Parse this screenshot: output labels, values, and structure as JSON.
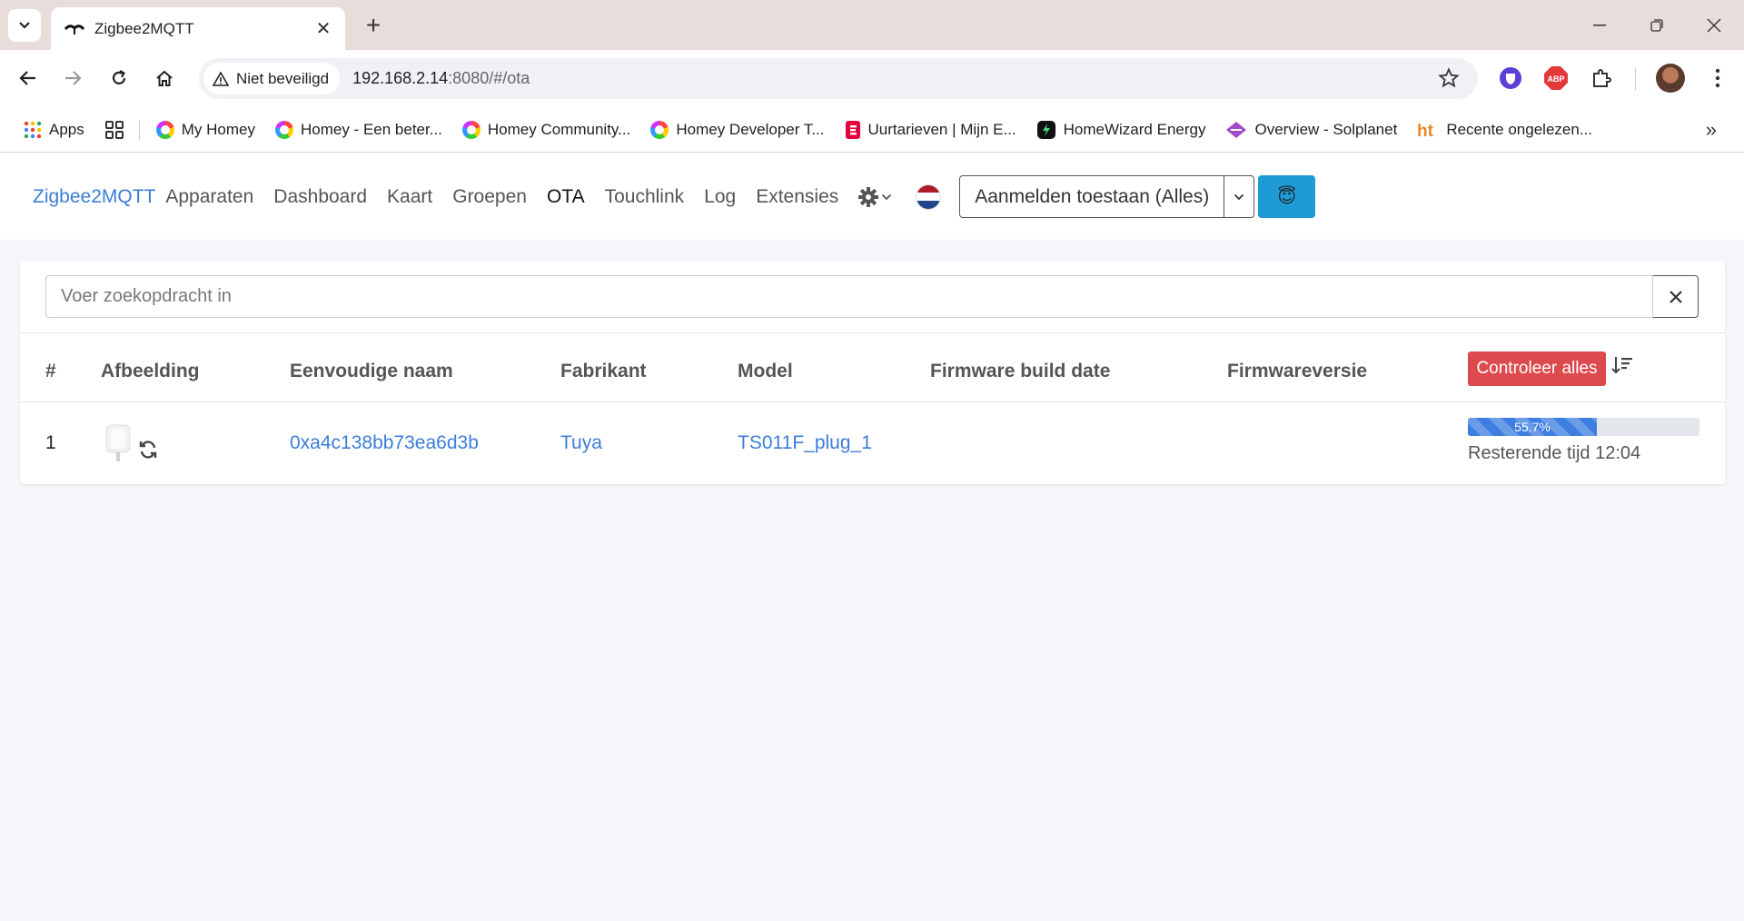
{
  "browser": {
    "tab_title": "Zigbee2MQTT",
    "security_label": "Niet beveiligd",
    "url_host": "192.168.2.14",
    "url_path": ":8080/#/ota",
    "bookmarks": [
      {
        "label": "Apps",
        "icon": "apps-grid-icon"
      },
      {
        "label": "My Homey",
        "icon": "homey-icon"
      },
      {
        "label": "Homey - Een beter...",
        "icon": "homey-icon"
      },
      {
        "label": "Homey Community...",
        "icon": "homey-icon"
      },
      {
        "label": "Homey Developer T...",
        "icon": "homey-icon"
      },
      {
        "label": "Uurtarieven | Mijn E...",
        "icon": "eneco-icon"
      },
      {
        "label": "HomeWizard Energy",
        "icon": "homewizard-icon"
      },
      {
        "label": "Overview - Solplanet",
        "icon": "solplanet-icon"
      },
      {
        "label": "Recente ongelezen...",
        "icon": "ht-icon"
      }
    ]
  },
  "nav": {
    "brand": "Zigbee2MQTT",
    "links": [
      "Apparaten",
      "Dashboard",
      "Kaart",
      "Groepen",
      "OTA",
      "Touchlink",
      "Log",
      "Extensies"
    ],
    "active": "OTA",
    "permit_join_label": "Aanmelden toestaan (Alles)",
    "emoji": "😇"
  },
  "search": {
    "placeholder": "Voer zoekopdracht in"
  },
  "table": {
    "headers": [
      "#",
      "Afbeelding",
      "Eenvoudige naam",
      "Fabrikant",
      "Model",
      "Firmware build date",
      "Firmwareversie"
    ],
    "check_all_label": "Controleer alles",
    "rows": [
      {
        "index": "1",
        "friendly_name": "0xa4c138bb73ea6d3b",
        "manufacturer": "Tuya",
        "model": "TS011F_plug_1",
        "firmware_build_date": "",
        "firmware_version": "",
        "progress_percent": 55.7,
        "progress_label": "55.7%",
        "remaining_label": "Resterende tijd 12:04"
      }
    ]
  },
  "colors": {
    "brand": "#3b7dd8",
    "danger": "#dc4a4d",
    "info": "#1e9bd7",
    "progress": "#3d7ee0"
  }
}
